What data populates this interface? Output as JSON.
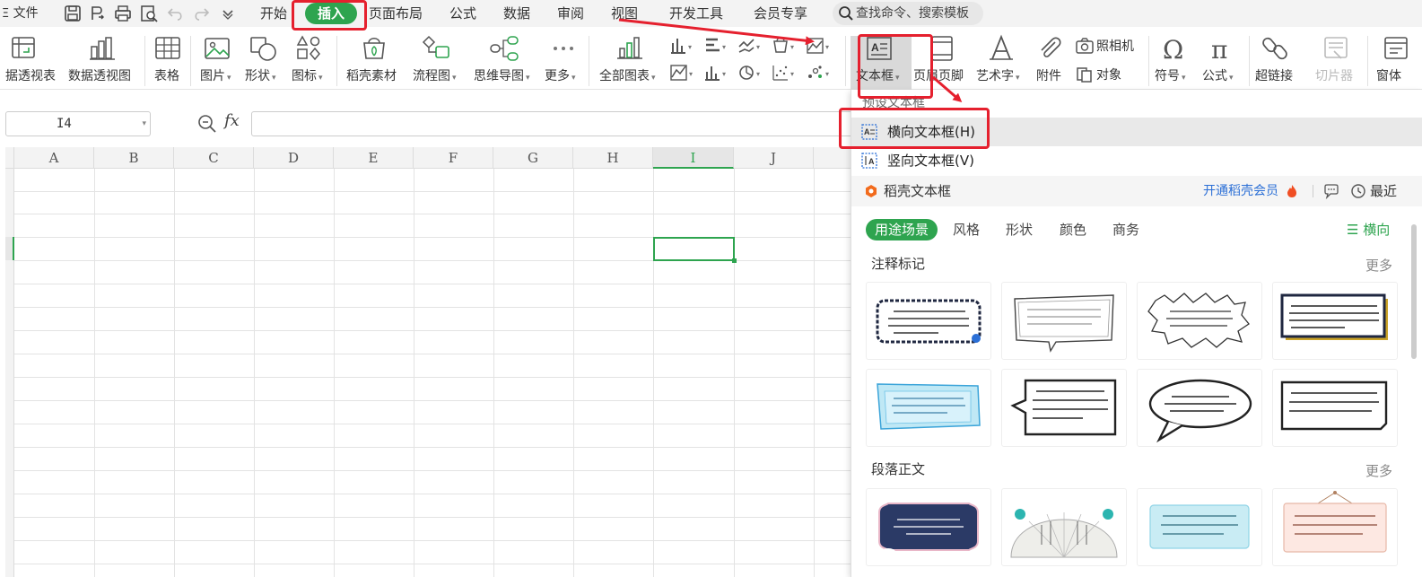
{
  "menubar": {
    "file_label": "文件",
    "tabs": [
      "开始",
      "插入",
      "页面布局",
      "公式",
      "数据",
      "审阅",
      "视图",
      "开发工具",
      "会员专享"
    ],
    "active_tab": "插入",
    "search_text": "查找命令、搜索模板"
  },
  "ribbon": {
    "pivot_table": "据透视表",
    "pivot_chart": "数据透视图",
    "table": "表格",
    "picture": "图片",
    "shape": "形状",
    "icon": "图标",
    "material": "稻壳素材",
    "flowchart": "流程图",
    "mindmap": "思维导图",
    "more": "更多",
    "all_charts": "全部图表",
    "camera": "照相机",
    "object": "对象",
    "textbox": "文本框",
    "header_footer": "页眉页脚",
    "wordart": "艺术字",
    "attachment": "附件",
    "symbol": "符号",
    "formula": "公式",
    "hyperlink": "超链接",
    "slicer": "切片器",
    "window": "窗体"
  },
  "formula_bar": {
    "name_box": "I4",
    "fx_label": "fx",
    "formula": ""
  },
  "grid": {
    "columns": [
      "A",
      "B",
      "C",
      "D",
      "E",
      "F",
      "G",
      "H",
      "I",
      "J"
    ],
    "selected_column": "I"
  },
  "textbox_menu": {
    "preset_header": "预设文本框",
    "items": [
      "横向文本框(H)",
      "竖向文本框(V)"
    ],
    "store_label": "稻壳文本框",
    "vip_link": "开通稻壳会员",
    "recent": "最近",
    "filter_tabs": [
      "用途场景",
      "风格",
      "形状",
      "颜色",
      "商务"
    ],
    "orientation": "横向",
    "categories": [
      "注释标记",
      "段落正文"
    ],
    "more_label": "更多"
  },
  "colors": {
    "accent_green": "#2ea44f",
    "annotation_red": "#e5202e",
    "vip_blue": "#2b6fd6"
  }
}
